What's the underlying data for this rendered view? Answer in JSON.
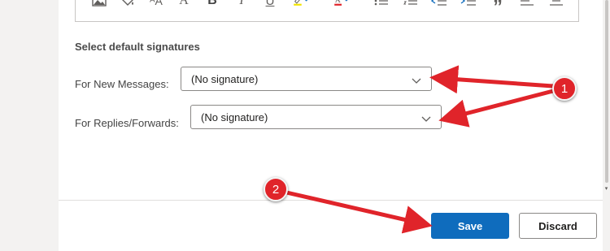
{
  "toolbar": {
    "icons": [
      "image-icon",
      "paint-bucket-icon",
      "font-size-icon",
      "font-icon",
      "bold-icon",
      "italic-icon",
      "underline-icon",
      "highlight-icon",
      "font-color-icon",
      "bullets-icon",
      "numbering-icon",
      "decrease-indent-icon",
      "increase-indent-icon",
      "quote-icon",
      "align-left-icon",
      "align-center-icon"
    ],
    "bold": "B",
    "italic": "I",
    "underline": "U",
    "font_size_glyph": "ᴬA",
    "font_glyph": "A",
    "quote": "”",
    "highlight_color": "#f2e500",
    "font_color": "#e0242a"
  },
  "signatures": {
    "title": "Select default signatures",
    "new_messages_label": "For New Messages:",
    "new_messages_value": "(No signature)",
    "replies_label": "For Replies/Forwards:",
    "replies_value": "(No signature)"
  },
  "footer": {
    "save_label": "Save",
    "discard_label": "Discard"
  },
  "annotations": {
    "badge_1": "1",
    "badge_2": "2",
    "color": "#e0242a"
  },
  "colors": {
    "primary": "#0f6cbd"
  }
}
